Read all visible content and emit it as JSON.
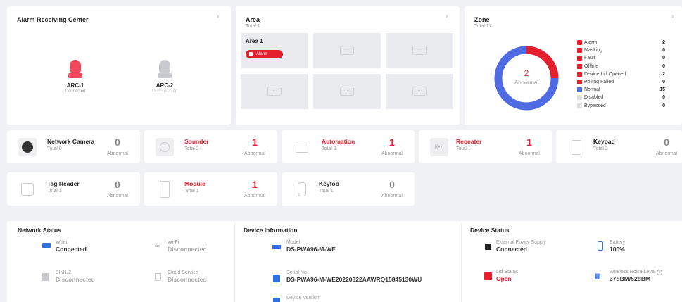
{
  "arc": {
    "title": "Alarm Receiving Center",
    "items": [
      {
        "name": "ARC-1",
        "status": "Connected",
        "color": "#ef4a5b"
      },
      {
        "name": "ARC-2",
        "status": "Disconnected",
        "color": "#c8cad0"
      }
    ]
  },
  "area": {
    "title": "Area",
    "total": "Total 1",
    "tiles": [
      {
        "name": "Area 1",
        "badge": "Alarm"
      }
    ]
  },
  "zone": {
    "title": "Zone",
    "total": "Total 17",
    "donut_value": "2",
    "donut_label": "Abnormal",
    "legend": [
      {
        "label": "Alarm",
        "value": "2",
        "color": "#e3202c"
      },
      {
        "label": "Masking",
        "value": "0",
        "color": "#e3202c"
      },
      {
        "label": "Fault",
        "value": "0",
        "color": "#e3202c"
      },
      {
        "label": "Offline",
        "value": "0",
        "color": "#e3202c"
      },
      {
        "label": "Device Lid Opened",
        "value": "2",
        "color": "#e3202c"
      },
      {
        "label": "Polling Failed",
        "value": "0",
        "color": "#e3202c"
      },
      {
        "label": "Normal",
        "value": "15",
        "color": "#4e6be3"
      },
      {
        "label": "Disabled",
        "value": "0",
        "color": "#e0e0e0"
      },
      {
        "label": "Bypassed",
        "value": "0",
        "color": "#e0e0e0"
      }
    ]
  },
  "devices": [
    {
      "name": "Network Camera",
      "total": "Total 0",
      "count": "0",
      "abnormal": "Abnormal"
    },
    {
      "name": "Sounder",
      "total": "Total 2",
      "count": "1",
      "abnormal": "Abnormal"
    },
    {
      "name": "Automation",
      "total": "Total 2",
      "count": "1",
      "abnormal": "Abnormal"
    },
    {
      "name": "Repeater",
      "total": "Total 1",
      "count": "1",
      "abnormal": "Abnormal"
    },
    {
      "name": "Keypad",
      "total": "Total 2",
      "count": "0",
      "abnormal": "Abnormal"
    },
    {
      "name": "Tag Reader",
      "total": "Total 1",
      "count": "0",
      "abnormal": "Abnormal"
    },
    {
      "name": "Module",
      "total": "Total 1",
      "count": "1",
      "abnormal": "Abnormal"
    },
    {
      "name": "Keyfob",
      "total": "Total 1",
      "count": "0",
      "abnormal": "Abnormal"
    }
  ],
  "network": {
    "title": "Network Status",
    "wired_label": "Wired",
    "wired_value": "Connected",
    "wifi_label": "Wi-Fi",
    "wifi_value": "Disconnected",
    "sim_label": "SIM1/2",
    "sim_value": "Disconnected",
    "cloud_label": "Cloud Service",
    "cloud_value": "Disconnected"
  },
  "device_info": {
    "title": "Device Information",
    "model_label": "Model",
    "model_value": "DS-PWA96-M-WE",
    "serial_label": "Serial No.",
    "serial_value": "DS-PWA96-M-WE20220822AAWRQ15845130WU",
    "version_label": "Device Version"
  },
  "device_status": {
    "title": "Device Status",
    "power_label": "External Power Supply",
    "power_value": "Connected",
    "battery_label": "Battery",
    "battery_value": "100%",
    "lid_label": "Lid Status",
    "lid_value": "Open",
    "noise_label": "Wireless Noise Level",
    "noise_value": "37dBM/52dBM"
  }
}
